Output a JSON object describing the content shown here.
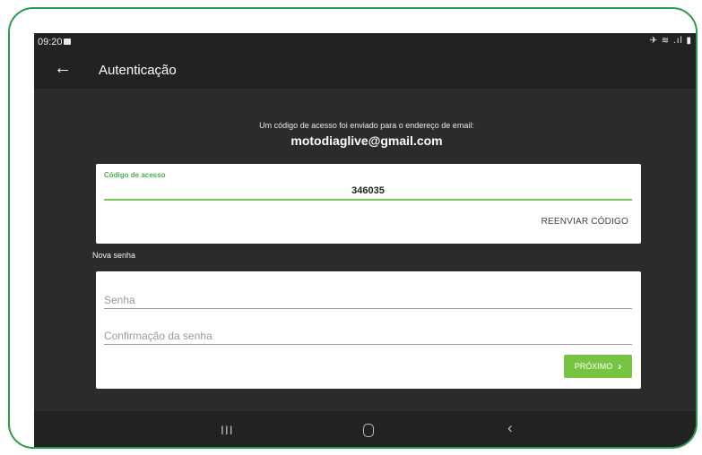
{
  "status_bar": {
    "time": "09:20",
    "icons": "✈ ≋ .ıl ▮"
  },
  "app_bar": {
    "back_icon": "←",
    "title": "Autenticação"
  },
  "info": {
    "message": "Um código de acesso foi enviado para o endereço de email:",
    "email": "motodiaglive@gmail.com"
  },
  "code_card": {
    "label": "Código de acesso",
    "value": "346035",
    "resend_label": "REENVIAR CÓDIGO"
  },
  "password_section": {
    "title": "Nova senha",
    "password_placeholder": "Senha",
    "confirm_placeholder": "Confirmação da senha",
    "next_label": "PRÓXIMO",
    "next_chevron": "›"
  },
  "nav_bar": {
    "recent_icon": "III",
    "back_icon": "‹"
  },
  "colors": {
    "accent": "#76c442",
    "frame_border": "#2e9a4a",
    "screen_bg": "#2b2b2b",
    "bar_bg": "#222222"
  }
}
